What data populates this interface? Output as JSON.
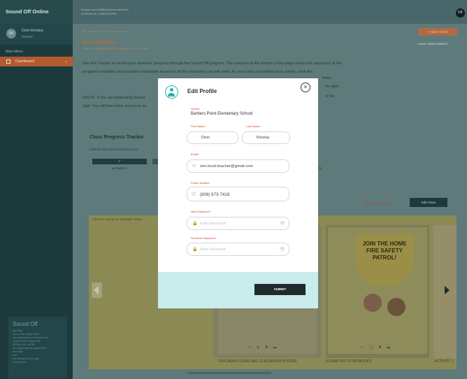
{
  "app": {
    "title": "Sound Off Online"
  },
  "sidebar": {
    "user_initials": "DK",
    "user_name": "Dom Kinsley",
    "user_role": "Teacher",
    "menu_title": "Main Menu",
    "items": [
      {
        "label": "Dashboard"
      }
    ],
    "footer_title": "Sound Off",
    "footer_lines": [
      "and Stay",
      "Home Fire Safety Patrol",
      "are trademarks & endorsed and",
      "©2018 NFPA. Vision Part",
      "(©2018 2021 NFPA)",
      "and organizations expand their",
      "Fire Risk",
      "and",
      "Partnership Technology",
      "Corporation"
    ]
  },
  "topbar": {
    "support_line": "Support: soundoff@pinetreeconsult.com",
    "phone_line": "or toll free at: 1-800-878-9025",
    "avatar_initials": "DK"
  },
  "main": {
    "breadcrumb": "My Classes / Class 1: Kinsley Klass",
    "page_title": "Dom Kinsley",
    "class_info": "Class 1: Kinsley Klass  |  25 Students  |  0 FF Visits",
    "add_class": "+ Add a Class",
    "local_team": "LOCAL TEAM CONTACT",
    "intro": "Use this Tracker to record your students' progress through the Sound Off program. The carousel at the bottom of this page shows the sequence of the program's activities and provides immediate access to all the resources you will need. As your class completes each activity, click the",
    "intro_right1": "Team.",
    "intro_right2": "he right.",
    "note": "(NOTE: If you are presenting Sound",
    "note_right": "o the",
    "note_line2": "right. You will then have access to se",
    "tracker_title": "Class Progress Tracker",
    "tracker_sub": "Click the appropriate button as you ",
    "activity1_check": "✓",
    "activity1_label": "ACTIVITY 1",
    "activity3_label": "TY",
    "delete_class": "Delete this Class",
    "edit_class": "Edit Class"
  },
  "carousel": {
    "hint": "Click the activity for available classr",
    "badge_text": "JOIN THE HOME FIRE SAFETY PATROL!",
    "cards": [
      {
        "label": "TEACHER'S GUIDE AND CLASSROOM POSTER"
      },
      {
        "label": "SOUND OFF STORYBOOKS"
      },
      {
        "label": "ACTIVITY 1"
      }
    ]
  },
  "modal": {
    "title": "Edit Profile",
    "school_label": "School",
    "school_value": "Barbers Point Elementary School",
    "first_name_label": "First Name*",
    "first_name_value": "Dom",
    "last_name_label": "Last Name*",
    "last_name_value": "Kinsley",
    "email_label": "Email*",
    "email_value": "soo.local.teacher@gmail.com",
    "phone_label": "Phone Number",
    "phone_value": "(808) 673-7418",
    "new_password_label": "New Password*",
    "new_password_placeholder": "Enter Password",
    "reenter_password_label": "Re-Enter Password*",
    "reenter_password_placeholder": "Enter Password",
    "submit_label": "SUBMIT"
  },
  "colors": {
    "accent_teal": "#27b3a9",
    "label_orange": "#d0451c",
    "submit_dark": "#1e2a2b",
    "modal_footer": "#c9ecec"
  }
}
